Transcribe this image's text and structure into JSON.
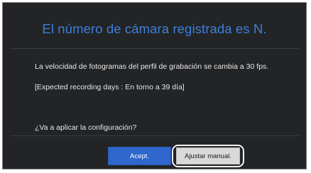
{
  "dialog": {
    "title": "El número de cámara registrada es N.",
    "message_line_1": "La velocidad de fotogramas del perfil de grabación se cambia a 30 fps.",
    "message_line_2": "[Expected recording days : En torno a 39 día]",
    "question": "¿Va a aplicar la configuración?",
    "buttons": {
      "accept_label": "Acept.",
      "manual_label": "Ajustar manual."
    }
  },
  "colors": {
    "background": "#222426",
    "title": "#3f7fd8",
    "accept_button": "#2f67cc",
    "manual_button": "#d9d9d9"
  }
}
